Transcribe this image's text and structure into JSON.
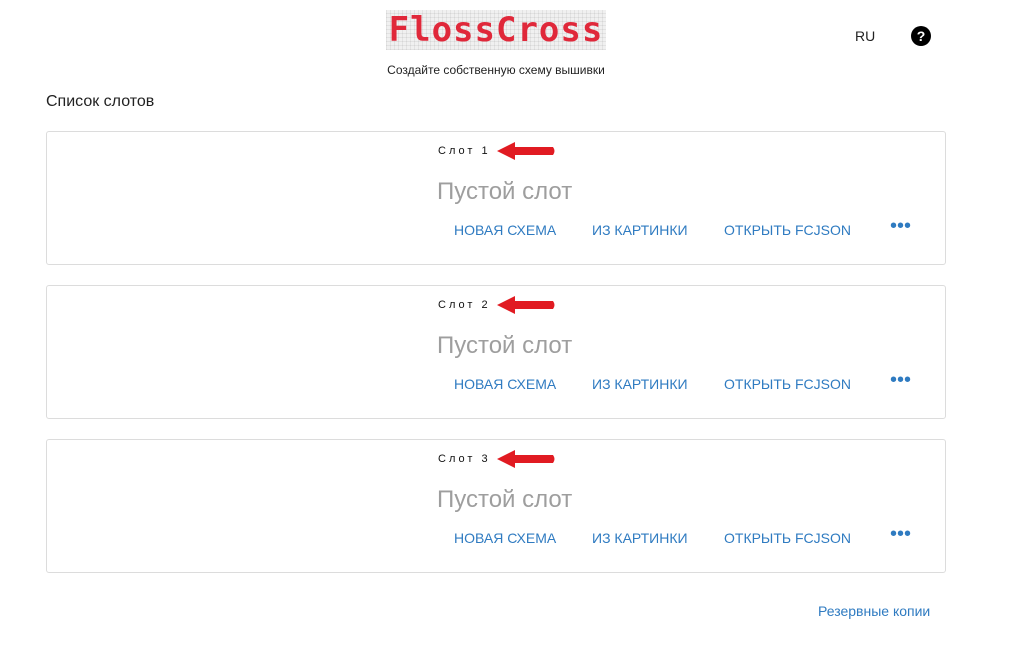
{
  "header": {
    "logo_text": "FlossCross",
    "tagline": "Создайте собственную схему вышивки",
    "language": "RU",
    "help_glyph": "?"
  },
  "section_title": "Список слотов",
  "slots": [
    {
      "name": "Слот 1",
      "status": "Пустой слот"
    },
    {
      "name": "Слот 2",
      "status": "Пустой слот"
    },
    {
      "name": "Слот 3",
      "status": "Пустой слот"
    }
  ],
  "slot_actions": {
    "new_scheme": "НОВАЯ СХЕМА",
    "from_image": "ИЗ КАРТИНКИ",
    "open_fcjson": "ОТКРЫТЬ FCJSON",
    "more": "•••"
  },
  "footer": {
    "backups_link": "Резервные копии"
  },
  "colors": {
    "logo_red": "#e0283a",
    "link_blue": "#2f7bc1",
    "annotation_arrow": "#e11b22",
    "muted_text": "#9e9e9e"
  },
  "icons": {
    "help": "help-circle-icon",
    "more": "more-horizontal-icon",
    "annotation": "red-arrow-icon"
  }
}
